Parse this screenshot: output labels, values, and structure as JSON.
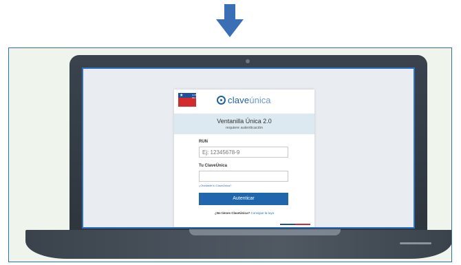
{
  "icons": {
    "arrow": "arrow-down-icon",
    "brand": "claveunica-logo-icon",
    "gov": "gobierno-de-chile-logo"
  },
  "colors": {
    "arrow": "#3a6fb5",
    "frame_border": "#2a6fb0",
    "frame_bg": "#eff5ec",
    "laptop": "#353d46",
    "screen_border": "#2f6fc0",
    "brand_primary": "#1f5fa8",
    "brand_secondary": "#6b9ad3",
    "banner_bg": "#dce9f0",
    "button_bg": "#1f66ad",
    "link": "#2a6fb8",
    "flag_blue": "#1e4e9c",
    "flag_red": "#d22b2b"
  },
  "gov_logo": {
    "text": "GOBIERNO DE CHILE"
  },
  "brand": {
    "part1": "clave",
    "part2": "única"
  },
  "banner": {
    "title": "Ventanilla Única 2.0",
    "subtitle": "requiere autenticación"
  },
  "form": {
    "run_label": "RUN",
    "run_placeholder": "Ej: 12345678-9",
    "clave_label": "Tu ClaveÚnica",
    "clave_placeholder": "",
    "forgot_link": "¿Olvidaste tu ClaveÚnica?",
    "submit_label": "Autenticar",
    "signup_question": "¿No tienes ClaveÚnica?",
    "signup_link": "Consigue la tuya"
  }
}
